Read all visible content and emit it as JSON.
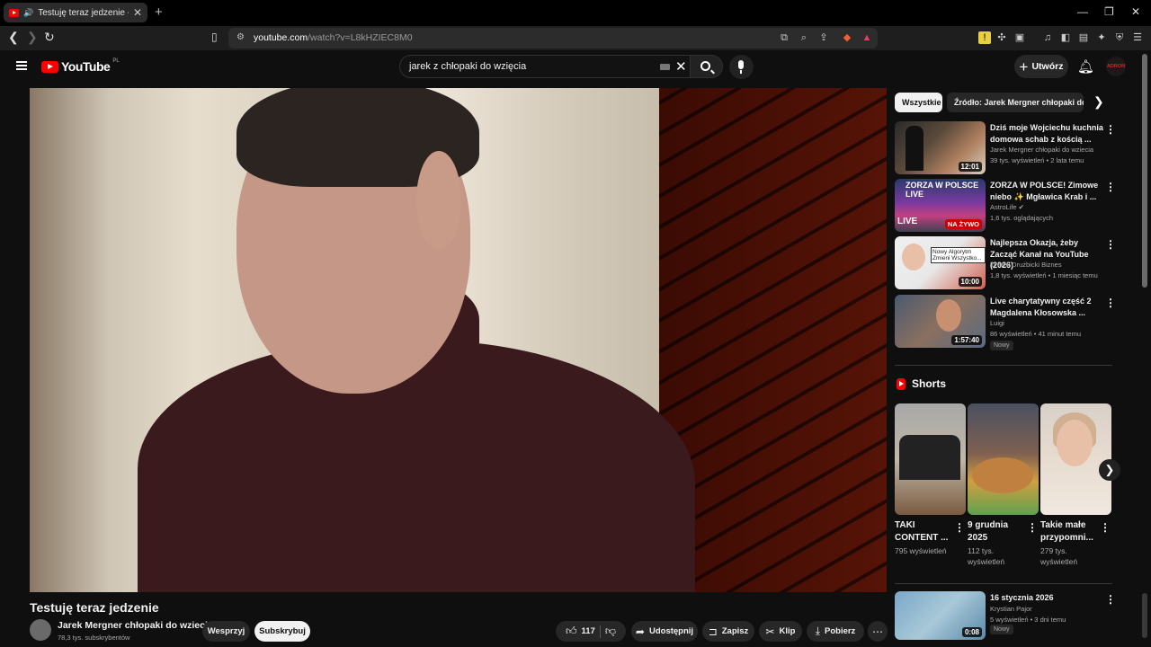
{
  "browser": {
    "tab_title": "Testuję teraz jedzenie - YouTu",
    "tab_close": "✕",
    "new_tab": "+",
    "url_host": "youtube.com",
    "url_path": "/watch?v=L8kHZIEC8M0",
    "window_controls": [
      "—",
      "❐",
      "✕"
    ]
  },
  "youtube": {
    "logo_word": "YouTube",
    "country_code": "PL",
    "search_value": "jarek z chłopaki do wzięcia",
    "create_label": "Utwórz",
    "avatar_text": "ADRON"
  },
  "video": {
    "title": "Testuję teraz jedzenie",
    "channel_name": "Jarek Mergner chłopaki do wziecia",
    "subscribers": "78,3 tys. subskrybentów",
    "support_label": "Wesprzyj",
    "subscribe_label": "Subskrybuj",
    "like_count": "117",
    "share_label": "Udostępnij",
    "save_label": "Zapisz",
    "clip_label": "Klip",
    "download_label": "Pobierz"
  },
  "chips": {
    "all": "Wszystkie",
    "source": "Źródło: Jarek Mergner chłopaki do wzięcia"
  },
  "recommendations": [
    {
      "title": "Dziś moje Wojciechu kuchnia domowa schab z kością ...",
      "channel": "Jarek Mergner chłopaki do wziecia",
      "meta": "39 tys. wyświetleń • 2 lata temu",
      "duration": "12:01"
    },
    {
      "title": "ZORZA W POLSCE! Zimowe niebo ✨ Mgławica Krab i ...",
      "channel": "AstroLife ✔",
      "meta": "1,6 tys. oglądających",
      "badge": "NA ŻYWO",
      "thumb_top": "ZORZA W POLSCE LIVE",
      "thumb_live": "LIVE"
    },
    {
      "title": "Najlepsza Okazja, żeby Zacząć Kanał na YouTube (2026)",
      "channel": "Tymek Drużbicki Biznes",
      "meta": "1,8 tys. wyświetleń • 1 miesiąc temu",
      "duration": "10:00",
      "thumb_text": "Nowy Algorytm Zmieni Wszystko..."
    },
    {
      "title": "Live charytatywny część 2 Magdalena Kłosowska ...",
      "channel": "Luigi",
      "meta": "86 wyświetleń • 41 minut temu",
      "duration": "1:57:40",
      "new": "Nowy"
    }
  ],
  "shorts": {
    "heading": "Shorts",
    "items": [
      {
        "title": "TAKI CONTENT ...",
        "views": "795 wyświetleń"
      },
      {
        "title": "9 grudnia 2025",
        "views": "112 tys. wyświetleń"
      },
      {
        "title": "Takie małe przypomni...",
        "views": "279 tys. wyświetleń"
      }
    ]
  },
  "bottom_rec": {
    "title": "16 stycznia 2026",
    "channel": "Krystian Pajor",
    "meta": "5 wyświetleń • 3 dni temu",
    "duration": "0:08",
    "new": "Nowy"
  }
}
